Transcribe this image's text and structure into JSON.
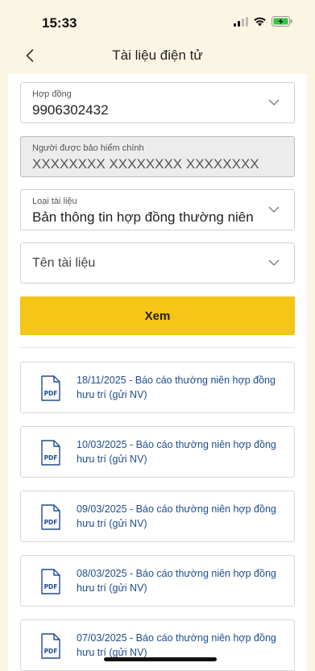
{
  "status": {
    "time": "15:33"
  },
  "header": {
    "title": "Tài liệu điện tử",
    "back_icon": "chevron-left-icon"
  },
  "form": {
    "contract": {
      "label": "Hợp đồng",
      "value": "9906302432"
    },
    "insured": {
      "label": "Người được bảo hiểm chính",
      "value": "XXXXXXXX XXXXXXXX XXXXXXXX"
    },
    "doc_type": {
      "label": "Loại tài liệu",
      "value": "Bản thông tin hợp đồng thường niên"
    },
    "doc_name": {
      "placeholder": "Tên tài liệu"
    },
    "view_button": "Xem"
  },
  "documents": [
    {
      "line1": "18/11/2025 - Báo cáo thường niên hợp đồng",
      "line2": "hưu trí (gửi NV)"
    },
    {
      "line1": "10/03/2025 - Báo cáo thường niên hợp đồng",
      "line2": "hưu trí (gửi NV)"
    },
    {
      "line1": "09/03/2025 - Báo cáo thường niên hợp đồng",
      "line2": "hưu trí (gửi NV)"
    },
    {
      "line1": "08/03/2025 - Báo cáo thường niên hợp đồng",
      "line2": "hưu trí (gửi NV)"
    },
    {
      "line1": "07/03/2025 - Báo cáo thường niên hợp đồng",
      "line2": "hưu trí (gửi NV)"
    }
  ],
  "colors": {
    "accent": "#f5c517",
    "link": "#1f4d8c",
    "background": "#fbf6e4"
  }
}
